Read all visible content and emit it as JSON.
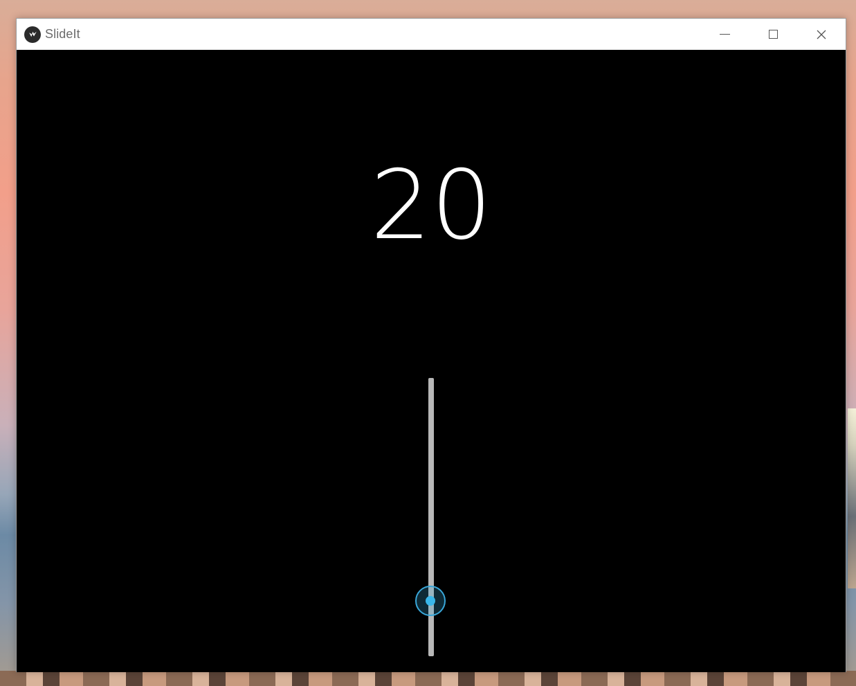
{
  "window": {
    "title": "SlideIt"
  },
  "icons": {
    "app": "kivy-logo-icon",
    "minimize": "minimize-icon",
    "maximize": "maximize-icon",
    "close": "close-icon"
  },
  "display": {
    "value": "20"
  },
  "slider": {
    "value": 20,
    "min": 0,
    "max": 100,
    "orientation": "vertical",
    "accent_color": "#39a7d9",
    "track_color": "#b8b8b8"
  }
}
